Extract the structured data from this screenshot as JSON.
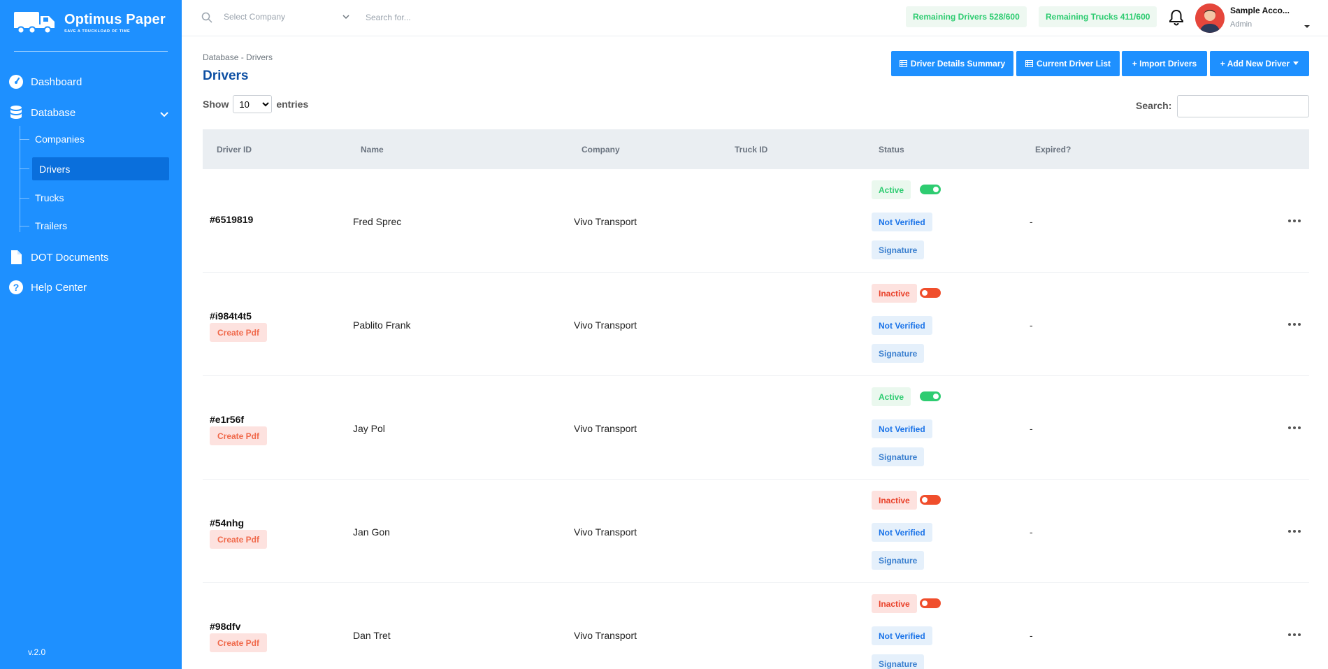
{
  "brand": {
    "name": "Optimus Paper",
    "tagline": "SAVE A TRUCKLOAD OF TIME"
  },
  "sidebar": {
    "items": [
      {
        "label": "Dashboard",
        "icon": "speedometer-icon"
      },
      {
        "label": "Database",
        "icon": "database-icon"
      },
      {
        "label": "DOT Documents",
        "icon": "document-icon"
      },
      {
        "label": "Help Center",
        "icon": "help-circle-icon"
      }
    ],
    "database_children": [
      {
        "label": "Companies"
      },
      {
        "label": "Drivers",
        "active": true
      },
      {
        "label": "Trucks"
      },
      {
        "label": "Trailers"
      }
    ],
    "version": "v.2.0"
  },
  "header": {
    "company_placeholder": "Select Company",
    "search_placeholder": "Search for...",
    "remaining_drivers": "Remaining Drivers 528/600",
    "remaining_trucks": "Remaining Trucks 411/600",
    "account_name": "Sample Acco...",
    "account_role": "Admin"
  },
  "page": {
    "breadcrumb": "Database - Drivers",
    "title": "Drivers",
    "buttons": {
      "summary": "Driver Details Summary",
      "current_list": "Current Driver List",
      "import": "+ Import Drivers",
      "add": "+ Add New Driver"
    },
    "show_label": "Show",
    "entries_label": "entries",
    "entries_value": "10",
    "search_label": "Search:"
  },
  "table": {
    "columns": [
      "Driver ID",
      "Name",
      "Company",
      "Truck ID",
      "Status",
      "Expired?"
    ],
    "rows": [
      {
        "id": "#6519819",
        "name": "Fred Sprec",
        "company": "Vivo Transport",
        "status": "Active",
        "create_pdf": "",
        "verified": "Not Verified",
        "signature": "Signature",
        "expired": "-"
      },
      {
        "id": "#i984t4t5",
        "name": "Pablito Frank",
        "company": "Vivo Transport",
        "status": "Inactive",
        "create_pdf": "Create Pdf",
        "verified": "Not Verified",
        "signature": "Signature",
        "expired": "-"
      },
      {
        "id": "#e1r56f",
        "name": "Jay Pol",
        "company": "Vivo Transport",
        "status": "Active",
        "create_pdf": "Create Pdf",
        "verified": "Not Verified",
        "signature": "Signature",
        "expired": "-"
      },
      {
        "id": "#54nhg",
        "name": "Jan Gon",
        "company": "Vivo Transport",
        "status": "Inactive",
        "create_pdf": "Create Pdf",
        "verified": "Not Verified",
        "signature": "Signature",
        "expired": "-"
      },
      {
        "id": "#98dfv",
        "name": "Dan Tret",
        "company": "Vivo Transport",
        "status": "Inactive",
        "create_pdf": "Create Pdf",
        "verified": "Not Verified",
        "signature": "Signature",
        "expired": "-"
      }
    ]
  },
  "colors": {
    "primary": "#1e90ff",
    "active": "#2ecc71",
    "inactive": "#f04e2c"
  }
}
